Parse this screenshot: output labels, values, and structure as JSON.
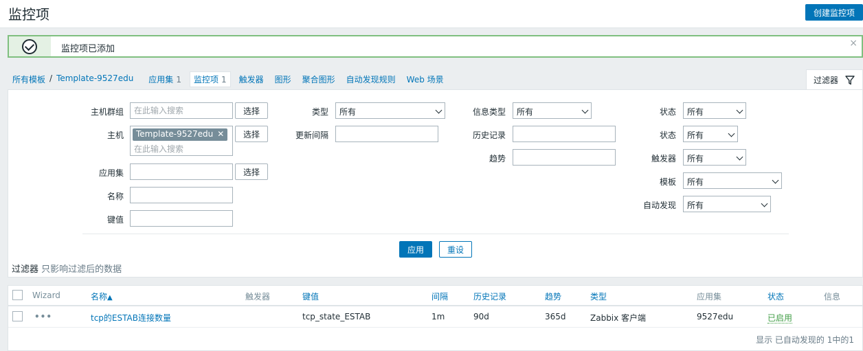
{
  "header": {
    "title": "监控项",
    "create_button": "创建监控项"
  },
  "message": {
    "text": "监控项已添加",
    "close": "×"
  },
  "nav": {
    "breadcrumb": [
      "所有模板",
      "Template-9527edu"
    ],
    "separator": "/",
    "tabs": [
      {
        "label": "应用集",
        "count": "1"
      },
      {
        "label": "监控项",
        "count": "1"
      },
      {
        "label": "触发器"
      },
      {
        "label": "图形"
      },
      {
        "label": "聚合图形"
      },
      {
        "label": "自动发现规则"
      },
      {
        "label": "Web 场景"
      }
    ],
    "filter_tab": "过滤器"
  },
  "filter": {
    "host_group": {
      "label": "主机群组",
      "placeholder": "在此输入搜索",
      "button": "选择"
    },
    "host": {
      "label": "主机",
      "chip": "Template-9527edu",
      "placeholder": "在此输入搜索",
      "button": "选择"
    },
    "application": {
      "label": "应用集",
      "button": "选择"
    },
    "name": {
      "label": "名称"
    },
    "key": {
      "label": "键值"
    },
    "type": {
      "label": "类型",
      "value": "所有"
    },
    "update_interval": {
      "label": "更新间隔"
    },
    "info_type": {
      "label": "信息类型",
      "value": "所有"
    },
    "history": {
      "label": "历史记录"
    },
    "trends": {
      "label": "趋势"
    },
    "state": {
      "label": "状态",
      "value": "所有"
    },
    "status": {
      "label": "状态",
      "value": "所有"
    },
    "triggers": {
      "label": "触发器",
      "value": "所有"
    },
    "template": {
      "label": "模板",
      "value": "所有"
    },
    "discovered": {
      "label": "自动发现",
      "value": "所有"
    },
    "apply": "应用",
    "reset": "重设",
    "note_bold": "过滤器",
    "note_rest": "只影响过滤后的数据"
  },
  "table": {
    "headers": {
      "wizard": "Wizard",
      "name": "名称",
      "sort_arrow": "▲",
      "triggers": "触发器",
      "key": "键值",
      "interval": "间隔",
      "history": "历史记录",
      "trends": "趋势",
      "type": "类型",
      "applications": "应用集",
      "status": "状态",
      "info": "信息"
    },
    "rows": [
      {
        "wizard": "•••",
        "name": "tcp的ESTAB连接数量",
        "triggers": "",
        "key": "tcp_state_ESTAB",
        "interval": "1m",
        "history": "90d",
        "trends": "365d",
        "type": "Zabbix 客户端",
        "applications": "9527edu",
        "status": "已启用",
        "info": ""
      }
    ],
    "footer": "显示 已自动发现的 1中的1"
  },
  "colors": {
    "accent": "#0275b8",
    "success_border": "#7fbf7f",
    "status_enabled": "#429e47"
  }
}
